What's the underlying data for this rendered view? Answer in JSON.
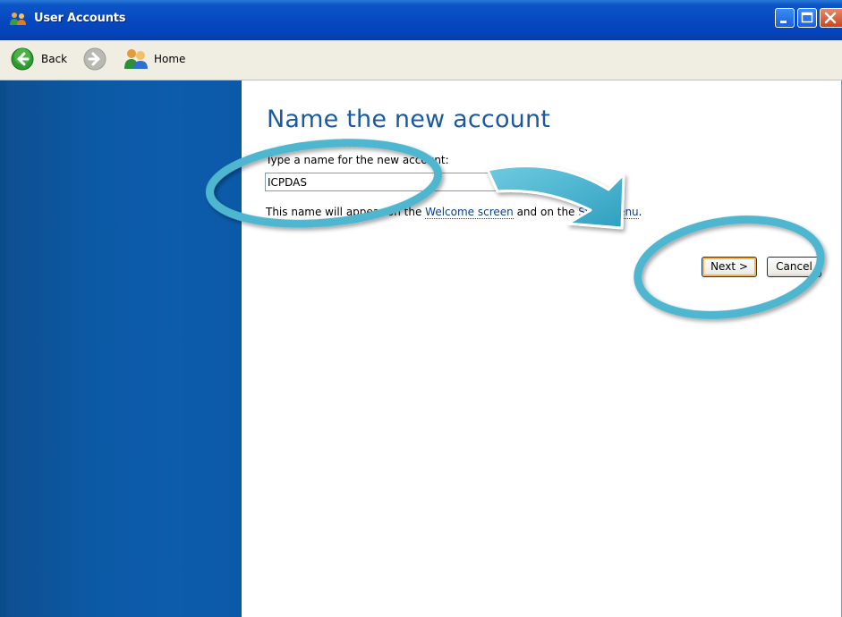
{
  "window": {
    "title": "User Accounts",
    "controls": {
      "minimize": "minimize",
      "maximize": "maximize",
      "close": "close"
    }
  },
  "toolbar": {
    "back_label": "Back",
    "home_label": "Home"
  },
  "main": {
    "heading": "Name the new account",
    "prompt": "Type a name for the new account:",
    "name_value": "ICPDAS",
    "hint_prefix": "This name will appear on the ",
    "hint_link1": "Welcome screen",
    "hint_middle": " and on the ",
    "hint_link2": "Start menu",
    "hint_suffix": "."
  },
  "buttons": {
    "next": "Next >",
    "cancel": "Cancel"
  },
  "colors": {
    "titlebar": "#0648c0",
    "sidebar": "#0b5aa6",
    "heading": "#1c5aa0",
    "annotation": "#4fb6cf"
  },
  "icons": {
    "title": "users-icon",
    "back": "back-arrow-icon",
    "forward": "forward-arrow-icon",
    "home": "users-home-icon"
  }
}
